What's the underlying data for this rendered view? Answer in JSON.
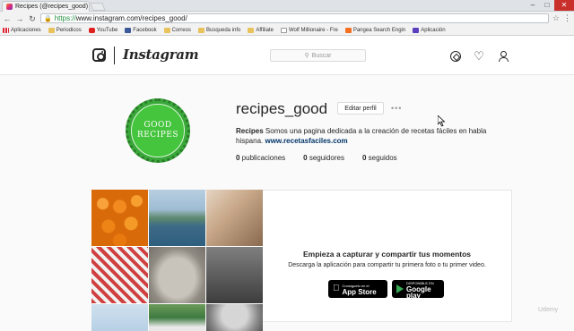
{
  "browser": {
    "tab_title": "Recipes (@recipes_good)",
    "tab_close": "×",
    "url_scheme": "https://",
    "url_host": "www.instagram.com/recipes_good/",
    "window_controls": [
      "–",
      "□",
      "✕"
    ],
    "bookmarks": [
      {
        "label": "Aplicaciones",
        "icon": "apps-icon"
      },
      {
        "label": "Periodicos",
        "icon": "folder-icon"
      },
      {
        "label": "YouTube",
        "icon": "youtube-icon"
      },
      {
        "label": "Facebook",
        "icon": "facebook-icon"
      },
      {
        "label": "Correos",
        "icon": "folder-icon"
      },
      {
        "label": "Busqueda info",
        "icon": "folder-icon"
      },
      {
        "label": "Affiliate",
        "icon": "folder-icon"
      },
      {
        "label": "Wolf Millionaire - Fre",
        "icon": "page-icon"
      },
      {
        "label": "Pangea Search Engin",
        "icon": "pangea-icon"
      },
      {
        "label": "Aplicación",
        "icon": "app-icon"
      }
    ]
  },
  "header": {
    "wordmark": "Instagram",
    "search_placeholder": "Buscar"
  },
  "profile": {
    "avatar_line1": "GOOD",
    "avatar_line2": "RECIPES",
    "username": "recipes_good",
    "edit_label": "Editar perfil",
    "more": "•••",
    "bio_name": "Recipes",
    "bio_text": " Somos una pagina dedicada a la creación de recetas fáciles en habla hispana. ",
    "bio_link": "www.recetasfaciles.com",
    "stats": {
      "posts_count": "0",
      "posts_label": " publicaciones",
      "followers_count": "0",
      "followers_label": " seguidores",
      "following_count": "0",
      "following_label": " seguidos"
    }
  },
  "promo": {
    "title": "Empieza a capturar y compartir tus momentos",
    "subtitle": "Descarga la aplicación para compartir tu primera foto o tu primer video.",
    "appstore_small": "Consíguelo en el",
    "appstore_big": "App Store",
    "gplay_small": "DISPONIBLE EN",
    "gplay_big": "Google play"
  },
  "watermark": "Udemy"
}
